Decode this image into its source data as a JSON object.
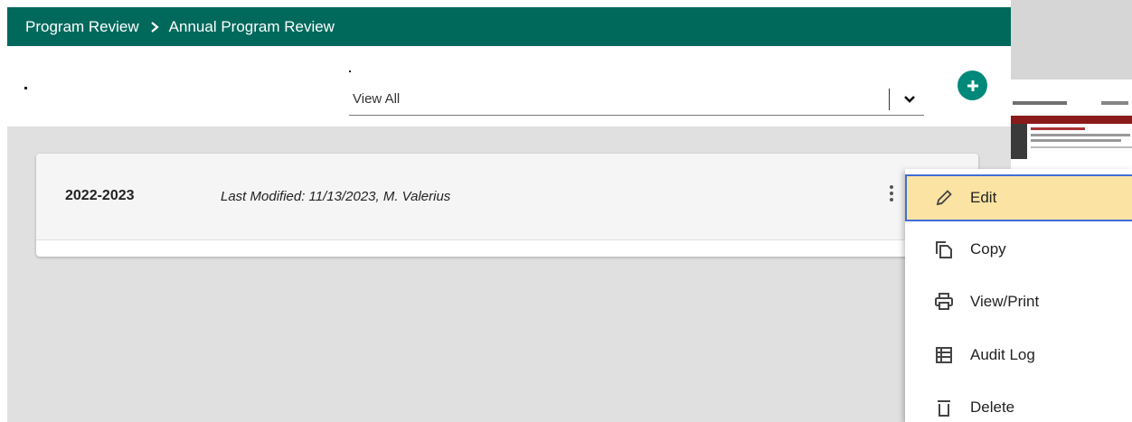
{
  "breadcrumb": {
    "parent": "Program Review",
    "current": "Annual Program Review"
  },
  "filter": {
    "selected": "View All"
  },
  "add_button": {
    "icon": "plus-icon"
  },
  "review": {
    "year": "2022-2023",
    "last_modified": "Last Modified: 11/13/2023, M. Valerius"
  },
  "menu": {
    "items": [
      {
        "label": "Edit",
        "icon": "pencil-icon"
      },
      {
        "label": "Copy",
        "icon": "copy-icon"
      },
      {
        "label": "View/Print",
        "icon": "print-icon"
      },
      {
        "label": "Audit Log",
        "icon": "list-icon"
      },
      {
        "label": "Delete",
        "icon": "trash-icon"
      }
    ]
  },
  "colors": {
    "header": "#00695c",
    "accent": "#00897b",
    "highlight": "#fbe3a3",
    "focus": "#3f6fd6"
  }
}
